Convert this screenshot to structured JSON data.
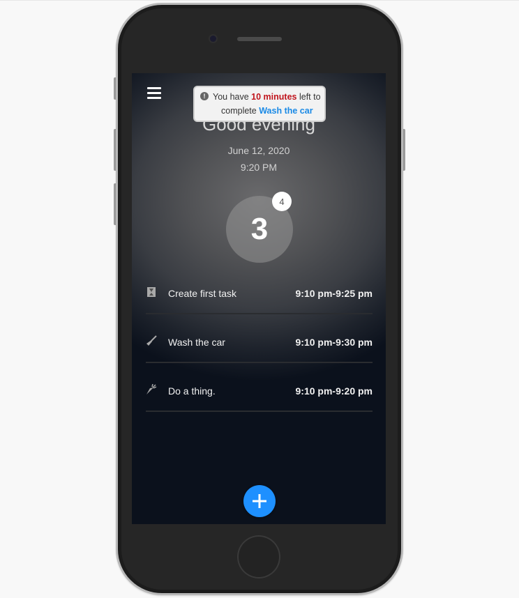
{
  "header": {
    "greeting": "Good evening",
    "date": "June 12, 2020",
    "time": "9:20 PM"
  },
  "counter": {
    "value": "3",
    "badge": "4"
  },
  "tasks": [
    {
      "icon": "hourglass-icon",
      "name": "Create first task",
      "time": "9:10 pm-9:25 pm"
    },
    {
      "icon": "broom-icon",
      "name": "Wash the car",
      "time": "9:10 pm-9:30 pm"
    },
    {
      "icon": "carrot-icon",
      "name": "Do a thing.",
      "time": "9:10 pm-9:20 pm"
    }
  ],
  "toast": {
    "prefix": "You have",
    "minutes": "10 minutes",
    "suffix": "left to",
    "complete_word": "complete",
    "task_name": "Wash the car"
  },
  "fab": {
    "icon": "plus-icon"
  },
  "colors": {
    "accent": "#1e90ff",
    "warning": "#c0141c",
    "link": "#1a8ae6"
  }
}
